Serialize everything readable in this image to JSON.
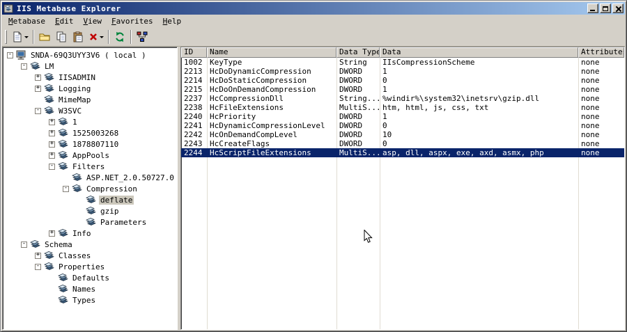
{
  "window": {
    "title": "IIS Metabase Explorer",
    "buttons": [
      {
        "name": "minimize-button"
      },
      {
        "name": "maximize-button"
      },
      {
        "name": "close-button"
      }
    ]
  },
  "colors": {
    "titlebar_start": "#0a246a",
    "titlebar_end": "#a6caf0",
    "selection": "#0a246a",
    "window_face": "#d4d0c8"
  },
  "menu": {
    "items": [
      {
        "label": "Metabase",
        "underline": 0
      },
      {
        "label": "Edit",
        "underline": 0
      },
      {
        "label": "View",
        "underline": 0
      },
      {
        "label": "Favorites",
        "underline": 0
      },
      {
        "label": "Help",
        "underline": 0
      }
    ]
  },
  "toolbar": {
    "buttons": [
      {
        "name": "new-key-button",
        "icon": "new-page-icon",
        "dropdown": true,
        "separator_after": true
      },
      {
        "name": "open-button",
        "icon": "folder-icon"
      },
      {
        "name": "copy-button",
        "icon": "copy-icon"
      },
      {
        "name": "paste-button",
        "icon": "paste-icon"
      },
      {
        "name": "delete-button",
        "icon": "delete-x-icon",
        "dropdown": true,
        "separator_after": true
      },
      {
        "name": "refresh-button",
        "icon": "refresh-icon",
        "separator_after": true
      },
      {
        "name": "connect-button",
        "icon": "network-icon"
      }
    ]
  },
  "tree": {
    "items": [
      {
        "label": "SNDA-69Q3UYY3V6 ( local )",
        "depth": 0,
        "expander": "-",
        "icon": "computer-icon"
      },
      {
        "label": "LM",
        "depth": 1,
        "expander": "-",
        "icon": "metabase-node-icon"
      },
      {
        "label": "IISADMIN",
        "depth": 2,
        "expander": "+",
        "icon": "metabase-node-icon"
      },
      {
        "label": "Logging",
        "depth": 2,
        "expander": "+",
        "icon": "metabase-node-icon"
      },
      {
        "label": "MimeMap",
        "depth": 2,
        "expander": "",
        "icon": "metabase-node-icon"
      },
      {
        "label": "W3SVC",
        "depth": 2,
        "expander": "-",
        "icon": "metabase-node-icon"
      },
      {
        "label": "1",
        "depth": 3,
        "expander": "+",
        "icon": "metabase-node-icon"
      },
      {
        "label": "1525003268",
        "depth": 3,
        "expander": "+",
        "icon": "metabase-node-icon"
      },
      {
        "label": "1878807110",
        "depth": 3,
        "expander": "+",
        "icon": "metabase-node-icon"
      },
      {
        "label": "AppPools",
        "depth": 3,
        "expander": "+",
        "icon": "metabase-node-icon"
      },
      {
        "label": "Filters",
        "depth": 3,
        "expander": "-",
        "icon": "metabase-node-icon"
      },
      {
        "label": "ASP.NET_2.0.50727.0",
        "depth": 4,
        "expander": "",
        "icon": "metabase-node-icon"
      },
      {
        "label": "Compression",
        "depth": 4,
        "expander": "-",
        "icon": "metabase-node-icon"
      },
      {
        "label": "deflate",
        "depth": 5,
        "expander": "",
        "icon": "metabase-node-icon",
        "selected": true
      },
      {
        "label": "gzip",
        "depth": 5,
        "expander": "",
        "icon": "metabase-node-icon"
      },
      {
        "label": "Parameters",
        "depth": 5,
        "expander": "",
        "icon": "metabase-node-icon"
      },
      {
        "label": "Info",
        "depth": 3,
        "expander": "+",
        "icon": "metabase-node-icon"
      },
      {
        "label": "Schema",
        "depth": 1,
        "expander": "-",
        "icon": "metabase-node-icon"
      },
      {
        "label": "Classes",
        "depth": 2,
        "expander": "+",
        "icon": "metabase-node-icon"
      },
      {
        "label": "Properties",
        "depth": 2,
        "expander": "-",
        "icon": "metabase-node-icon"
      },
      {
        "label": "Defaults",
        "depth": 3,
        "expander": "",
        "icon": "metabase-node-icon"
      },
      {
        "label": "Names",
        "depth": 3,
        "expander": "",
        "icon": "metabase-node-icon"
      },
      {
        "label": "Types",
        "depth": 3,
        "expander": "",
        "icon": "metabase-node-icon"
      }
    ]
  },
  "table": {
    "columns": [
      "ID",
      "Name",
      "Data Type",
      "Data",
      "Attributes"
    ],
    "rows": [
      {
        "id": "1002",
        "name": "KeyType",
        "type": "String",
        "data": "IIsCompressionScheme",
        "attributes": "none"
      },
      {
        "id": "2213",
        "name": "HcDoDynamicCompression",
        "type": "DWORD",
        "data": "1",
        "attributes": "none"
      },
      {
        "id": "2214",
        "name": "HcDoStaticCompression",
        "type": "DWORD",
        "data": "0",
        "attributes": "none"
      },
      {
        "id": "2215",
        "name": "HcDoOnDemandCompression",
        "type": "DWORD",
        "data": "1",
        "attributes": "none"
      },
      {
        "id": "2237",
        "name": "HcCompressionDll",
        "type": "String...",
        "data": "%windir%\\system32\\inetsrv\\gzip.dll",
        "attributes": "none"
      },
      {
        "id": "2238",
        "name": "HcFileExtensions",
        "type": "MultiS...",
        "data": "htm, html, js, css, txt",
        "attributes": "none"
      },
      {
        "id": "2240",
        "name": "HcPriority",
        "type": "DWORD",
        "data": "1",
        "attributes": "none"
      },
      {
        "id": "2241",
        "name": "HcDynamicCompressionLevel",
        "type": "DWORD",
        "data": "0",
        "attributes": "none"
      },
      {
        "id": "2242",
        "name": "HcOnDemandCompLevel",
        "type": "DWORD",
        "data": "10",
        "attributes": "none"
      },
      {
        "id": "2243",
        "name": "HcCreateFlags",
        "type": "DWORD",
        "data": "0",
        "attributes": "none"
      },
      {
        "id": "2244",
        "name": "HcScriptFileExtensions",
        "type": "MultiS...",
        "data": "asp, dll, aspx, exe, axd, asmx, php",
        "attributes": "none",
        "selected": true
      }
    ]
  }
}
